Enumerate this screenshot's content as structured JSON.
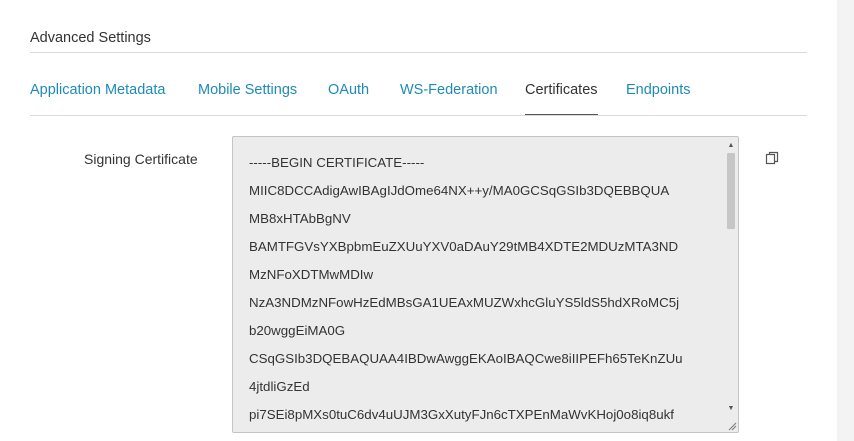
{
  "section": {
    "title": "Advanced Settings"
  },
  "tabs": [
    {
      "label": "Application Metadata",
      "active": false
    },
    {
      "label": "Mobile Settings",
      "active": false
    },
    {
      "label": "OAuth",
      "active": false
    },
    {
      "label": "WS-Federation",
      "active": false
    },
    {
      "label": "Certificates",
      "active": true
    },
    {
      "label": "Endpoints",
      "active": false
    }
  ],
  "signing_certificate": {
    "label": "Signing Certificate",
    "lines": [
      "-----BEGIN CERTIFICATE-----",
      "MIIC8DCCAdigAwIBAgIJdOme64NX++y/MA0GCSqGSIb3DQEBBQUA",
      "MB8xHTAbBgNV",
      "BAMTFGVsYXBpbmEuZXUuYXV0aDAuY29tMB4XDTE2MDUzMTA3ND",
      "MzNFoXDTMwMDIw",
      "NzA3NDMzNFowHzEdMBsGA1UEAxMUZWxhcGluYS5ldS5hdXRoMC5j",
      "b20wggEiMA0G",
      "CSqGSIb3DQEBAQUAA4IBDwAwggEKAoIBAQCwe8iIIPEFh65TeKnZUu",
      "4jtdliGzEd",
      "pi7SEi8pMXs0tuC6dv4uUJM3GxXutyFJn6cTXPEnMaWvKHoj0o8iq8ukf"
    ]
  },
  "icons": {
    "copy": "copy-icon",
    "scroll_up": "arrow-up-icon",
    "scroll_down": "arrow-down-icon",
    "resize": "resize-grip-icon"
  },
  "colors": {
    "link": "#1e8bb5",
    "active_tab": "#333333",
    "textarea_bg": "#ececec"
  }
}
